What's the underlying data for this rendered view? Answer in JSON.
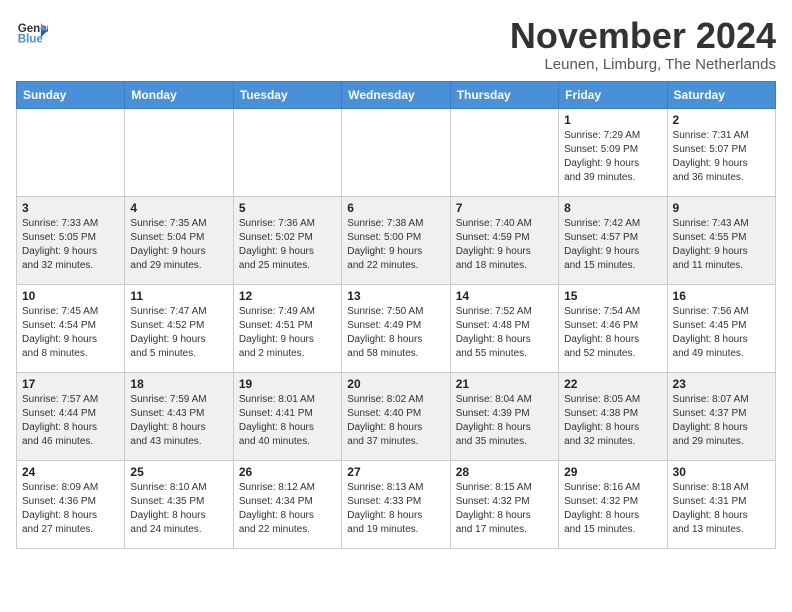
{
  "logo": {
    "line1": "General",
    "line2": "Blue"
  },
  "title": "November 2024",
  "location": "Leunen, Limburg, The Netherlands",
  "weekdays": [
    "Sunday",
    "Monday",
    "Tuesday",
    "Wednesday",
    "Thursday",
    "Friday",
    "Saturday"
  ],
  "weeks": [
    [
      {
        "day": "",
        "info": ""
      },
      {
        "day": "",
        "info": ""
      },
      {
        "day": "",
        "info": ""
      },
      {
        "day": "",
        "info": ""
      },
      {
        "day": "",
        "info": ""
      },
      {
        "day": "1",
        "info": "Sunrise: 7:29 AM\nSunset: 5:09 PM\nDaylight: 9 hours\nand 39 minutes."
      },
      {
        "day": "2",
        "info": "Sunrise: 7:31 AM\nSunset: 5:07 PM\nDaylight: 9 hours\nand 36 minutes."
      }
    ],
    [
      {
        "day": "3",
        "info": "Sunrise: 7:33 AM\nSunset: 5:05 PM\nDaylight: 9 hours\nand 32 minutes."
      },
      {
        "day": "4",
        "info": "Sunrise: 7:35 AM\nSunset: 5:04 PM\nDaylight: 9 hours\nand 29 minutes."
      },
      {
        "day": "5",
        "info": "Sunrise: 7:36 AM\nSunset: 5:02 PM\nDaylight: 9 hours\nand 25 minutes."
      },
      {
        "day": "6",
        "info": "Sunrise: 7:38 AM\nSunset: 5:00 PM\nDaylight: 9 hours\nand 22 minutes."
      },
      {
        "day": "7",
        "info": "Sunrise: 7:40 AM\nSunset: 4:59 PM\nDaylight: 9 hours\nand 18 minutes."
      },
      {
        "day": "8",
        "info": "Sunrise: 7:42 AM\nSunset: 4:57 PM\nDaylight: 9 hours\nand 15 minutes."
      },
      {
        "day": "9",
        "info": "Sunrise: 7:43 AM\nSunset: 4:55 PM\nDaylight: 9 hours\nand 11 minutes."
      }
    ],
    [
      {
        "day": "10",
        "info": "Sunrise: 7:45 AM\nSunset: 4:54 PM\nDaylight: 9 hours\nand 8 minutes."
      },
      {
        "day": "11",
        "info": "Sunrise: 7:47 AM\nSunset: 4:52 PM\nDaylight: 9 hours\nand 5 minutes."
      },
      {
        "day": "12",
        "info": "Sunrise: 7:49 AM\nSunset: 4:51 PM\nDaylight: 9 hours\nand 2 minutes."
      },
      {
        "day": "13",
        "info": "Sunrise: 7:50 AM\nSunset: 4:49 PM\nDaylight: 8 hours\nand 58 minutes."
      },
      {
        "day": "14",
        "info": "Sunrise: 7:52 AM\nSunset: 4:48 PM\nDaylight: 8 hours\nand 55 minutes."
      },
      {
        "day": "15",
        "info": "Sunrise: 7:54 AM\nSunset: 4:46 PM\nDaylight: 8 hours\nand 52 minutes."
      },
      {
        "day": "16",
        "info": "Sunrise: 7:56 AM\nSunset: 4:45 PM\nDaylight: 8 hours\nand 49 minutes."
      }
    ],
    [
      {
        "day": "17",
        "info": "Sunrise: 7:57 AM\nSunset: 4:44 PM\nDaylight: 8 hours\nand 46 minutes."
      },
      {
        "day": "18",
        "info": "Sunrise: 7:59 AM\nSunset: 4:43 PM\nDaylight: 8 hours\nand 43 minutes."
      },
      {
        "day": "19",
        "info": "Sunrise: 8:01 AM\nSunset: 4:41 PM\nDaylight: 8 hours\nand 40 minutes."
      },
      {
        "day": "20",
        "info": "Sunrise: 8:02 AM\nSunset: 4:40 PM\nDaylight: 8 hours\nand 37 minutes."
      },
      {
        "day": "21",
        "info": "Sunrise: 8:04 AM\nSunset: 4:39 PM\nDaylight: 8 hours\nand 35 minutes."
      },
      {
        "day": "22",
        "info": "Sunrise: 8:05 AM\nSunset: 4:38 PM\nDaylight: 8 hours\nand 32 minutes."
      },
      {
        "day": "23",
        "info": "Sunrise: 8:07 AM\nSunset: 4:37 PM\nDaylight: 8 hours\nand 29 minutes."
      }
    ],
    [
      {
        "day": "24",
        "info": "Sunrise: 8:09 AM\nSunset: 4:36 PM\nDaylight: 8 hours\nand 27 minutes."
      },
      {
        "day": "25",
        "info": "Sunrise: 8:10 AM\nSunset: 4:35 PM\nDaylight: 8 hours\nand 24 minutes."
      },
      {
        "day": "26",
        "info": "Sunrise: 8:12 AM\nSunset: 4:34 PM\nDaylight: 8 hours\nand 22 minutes."
      },
      {
        "day": "27",
        "info": "Sunrise: 8:13 AM\nSunset: 4:33 PM\nDaylight: 8 hours\nand 19 minutes."
      },
      {
        "day": "28",
        "info": "Sunrise: 8:15 AM\nSunset: 4:32 PM\nDaylight: 8 hours\nand 17 minutes."
      },
      {
        "day": "29",
        "info": "Sunrise: 8:16 AM\nSunset: 4:32 PM\nDaylight: 8 hours\nand 15 minutes."
      },
      {
        "day": "30",
        "info": "Sunrise: 8:18 AM\nSunset: 4:31 PM\nDaylight: 8 hours\nand 13 minutes."
      }
    ]
  ]
}
